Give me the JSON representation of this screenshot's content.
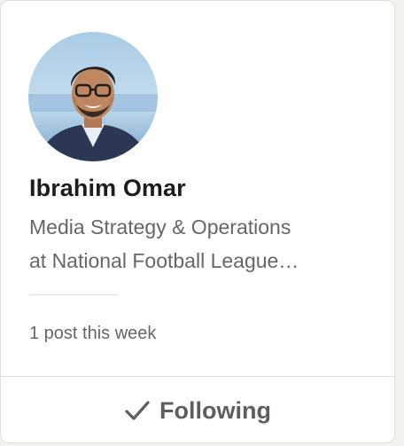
{
  "profile": {
    "name": "Ibrahim Omar",
    "headline_line1": "Media Strategy & Operations",
    "headline_line2": "at National Football League…",
    "activity": "1 post this week",
    "avatar_icon": "profile-photo"
  },
  "action": {
    "icon": "checkmark-icon",
    "label": "Following"
  },
  "colors": {
    "card_bg": "#ffffff",
    "name_text": "#1d1d1d",
    "secondary_text": "#666666",
    "button_text": "#5e5e5e"
  }
}
